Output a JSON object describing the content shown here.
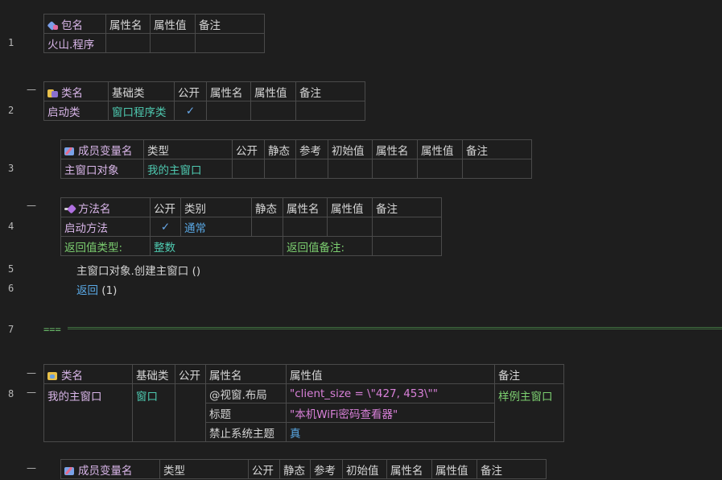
{
  "line_numbers": [
    "1",
    "2",
    "3",
    "4",
    "5",
    "6",
    "7",
    "8"
  ],
  "fold_marker": "—",
  "package_table": {
    "headers": [
      "包名",
      "属性名",
      "属性值",
      "备注"
    ],
    "row": [
      "火山.程序",
      "",
      "",
      ""
    ]
  },
  "class_table_1": {
    "headers": [
      "类名",
      "基础类",
      "公开",
      "属性名",
      "属性值",
      "备注"
    ],
    "row": [
      "启动类",
      "窗口程序类",
      "✓",
      "",
      "",
      ""
    ]
  },
  "member_table_1": {
    "headers": [
      "成员变量名",
      "类型",
      "公开",
      "静态",
      "参考",
      "初始值",
      "属性名",
      "属性值",
      "备注"
    ],
    "row": [
      "主窗口对象",
      "我的主窗口",
      "",
      "",
      "",
      "",
      "",
      "",
      ""
    ]
  },
  "method_table": {
    "headers": [
      "方法名",
      "公开",
      "类别",
      "静态",
      "属性名",
      "属性值",
      "备注"
    ],
    "row": [
      "启动方法",
      "✓",
      "通常",
      "",
      "",
      "",
      ""
    ],
    "return_type_label": "返回值类型:",
    "return_type_value": "整数",
    "return_note_label": "返回值备注:"
  },
  "code_lines": {
    "line5": "主窗口对象.创建主窗口 ()",
    "line6_keyword": "返回",
    "line6_args": "(1)",
    "line7": "==="
  },
  "class_table_2": {
    "headers": [
      "类名",
      "基础类",
      "公开",
      "属性名",
      "属性值",
      "备注"
    ],
    "name": "我的主窗口",
    "base": "窗口",
    "note": "样例主窗口",
    "props": [
      {
        "name": "@视窗.布局",
        "value": "\"client_size = \\\"427, 453\\\"\""
      },
      {
        "name": "标题",
        "value": "\"本机WiFi密码查看器\""
      },
      {
        "name": "禁止系统主题",
        "value": "真"
      }
    ]
  },
  "member_table_2": {
    "headers": [
      "成员变量名",
      "类型",
      "公开",
      "静态",
      "参考",
      "初始值",
      "属性名",
      "属性值",
      "备注"
    ]
  }
}
